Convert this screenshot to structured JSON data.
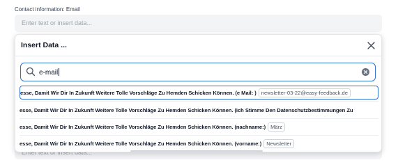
{
  "field": {
    "label": "Contact information: Email",
    "placeholder": "Enter text or insert data..."
  },
  "insert_data": {
    "title": "Insert Data ...",
    "search_value": "e-mail",
    "results": [
      {
        "text": "esse, Damit Wir Dir In Zukunft Weitere Tolle Vorschläge Zu Hemden Schicken Können. (e Mail: )",
        "value": "newsletter-03-22@easy-feedback.de",
        "selected": true
      },
      {
        "text": "esse, Damit Wir Dir In Zukunft Weitere Tolle Vorschläge Zu Hemden Schicken Können. (ich Stimme Den Datenschutzbestimmungen Zu",
        "value": "",
        "selected": false
      },
      {
        "text": "esse, Damit Wir Dir In Zukunft Weitere Tolle Vorschläge Zu Hemden Schicken Können. (nachname:)",
        "value": "März",
        "selected": false
      },
      {
        "text": "esse, Damit Wir Dir In Zukunft Weitere Tolle Vorschläge Zu Hemden Schicken Können. (vorname:)",
        "value": "Newsletter",
        "selected": false
      }
    ]
  },
  "colors": {
    "accent": "#2f6fcf",
    "input_bg": "#f3f4f6"
  },
  "icons": {
    "close": "close-icon",
    "search": "search-icon",
    "clear": "clear-icon"
  }
}
